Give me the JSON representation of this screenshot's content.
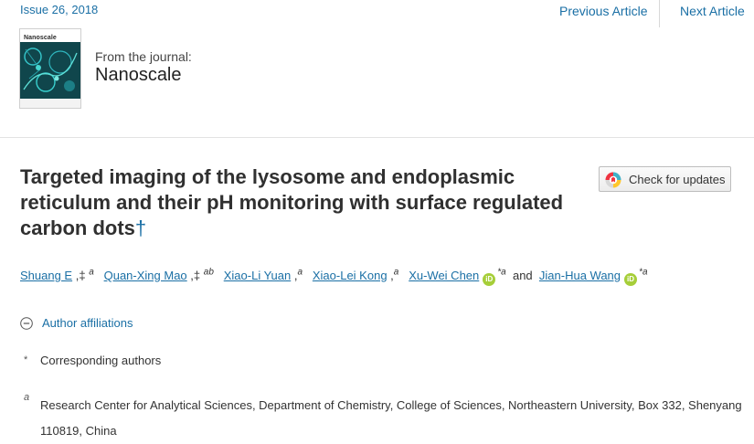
{
  "header": {
    "issue": "Issue 26, 2018",
    "previous_article": "Previous Article",
    "next_article": "Next Article"
  },
  "journal": {
    "cover_title": "Nanoscale",
    "from_label": "From the journal:",
    "name": "Nanoscale"
  },
  "article": {
    "title": "Targeted imaging of the lysosome and endoplasmic reticulum and their pH monitoring with surface regulated carbon dots",
    "dagger": "†",
    "check_updates": "Check for updates"
  },
  "authors": [
    {
      "name": "Shuang E",
      "marks": "‡",
      "affil": "a"
    },
    {
      "name": "Quan-Xing Mao",
      "marks": "‡",
      "affil": "ab"
    },
    {
      "name": "Xiao-Li Yuan",
      "marks": "",
      "affil": "a"
    },
    {
      "name": "Xiao-Lei Kong",
      "marks": "",
      "affil": "a"
    },
    {
      "name": "Xu-Wei Chen",
      "marks": "*",
      "affil": "a"
    },
    {
      "name": "Jian-Hua Wang",
      "marks": "*",
      "affil": "a"
    }
  ],
  "and_word": "and",
  "orcid_label": "iD",
  "affiliations": {
    "toggle_label": "Author affiliations",
    "corresponding_marker": "*",
    "corresponding_text": "Corresponding authors",
    "a_marker": "a",
    "a_text": "Research Center for Analytical Sciences, Department of Chemistry, College of Sciences, Northeastern University, Box 332, Shenyang 110819, China"
  },
  "colors": {
    "link": "#1a6fa5",
    "orcid": "#a6ce39"
  }
}
